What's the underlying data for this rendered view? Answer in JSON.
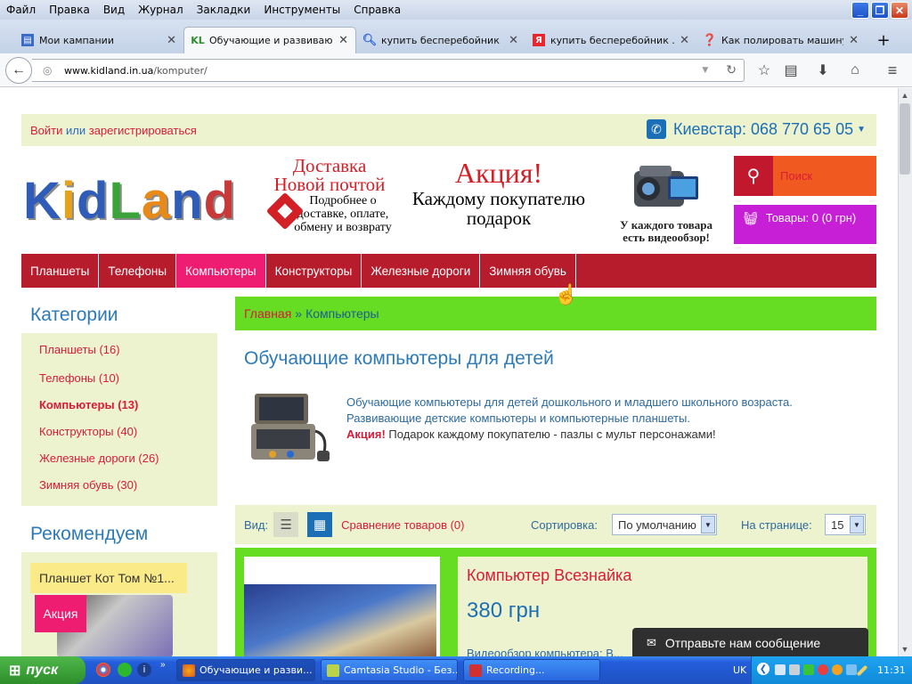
{
  "browser": {
    "menu": [
      "Файл",
      "Правка",
      "Вид",
      "Журнал",
      "Закладки",
      "Инструменты",
      "Справка"
    ],
    "tabs": [
      {
        "label": "Мои кампании",
        "icon": "campaigns-icon"
      },
      {
        "label": "Обучающие и развиваю...",
        "icon": "kidland-favicon"
      },
      {
        "label": "купить бесперебойник ...",
        "icon": "google-icon"
      },
      {
        "label": "купить бесперебойник ...",
        "icon": "yandex-icon"
      },
      {
        "label": "Как полировать машину ...",
        "icon": "question-icon"
      }
    ],
    "url_domain": "www.kidland.in.ua",
    "url_path": "/komputer/"
  },
  "site": {
    "login": "Войти",
    "or": " или ",
    "register": "зарегистрироваться",
    "phone": "Киевстар: 068 770 65 05",
    "logo": "KidLand",
    "delivery_title": "Доставка Новой почтой",
    "delivery_sub": "Подробнее о доставке, оплате, обмену и возврату",
    "promo_title": "Акция!",
    "promo_sub": "Каждому покупателю подарок",
    "video_text": "У каждого товара есть видеообзор!",
    "search_placeholder": "Поиск",
    "cart": "Товары: 0 (0 грн)",
    "nav": [
      "Планшеты",
      "Телефоны",
      "Компьютеры",
      "Конструкторы",
      "Железные дороги",
      "Зимняя обувь"
    ],
    "categories_title": "Категории",
    "categories": [
      "Планшеты (16)",
      "Телефоны (10)",
      "Компьютеры (13)",
      "Конструкторы (40)",
      "Железные дороги (26)",
      "Зимняя обувь (30)"
    ],
    "recommend_title": "Рекомендуем",
    "recommend_item": "Планшет Кот Том №1...",
    "recommend_badge": "Акция",
    "breadcrumb_home": "Главная",
    "breadcrumb_sep": "»",
    "breadcrumb_current": "Компьютеры",
    "page_title": "Обучающие компьютеры для детей",
    "desc_line1": "Обучающие компьютеры для детей дошкольного и младшего школьного возраста.",
    "desc_line2": "Развивающие детские компьютеры и компьютерные планшеты.",
    "desc_promo": "Акция!",
    "desc_promo_text": " Подарок каждому покупателю - пазлы с мульт персонажами!",
    "view_label": "Вид:",
    "compare": "Сравнение товаров (0)",
    "sort_label": "Сортировка:",
    "sort_value": "По умолчанию",
    "perpage_label": "На странице:",
    "perpage_value": "15",
    "product_name": "Компьютер Всезнайка",
    "product_price": "380 грн",
    "product_desc": "Видеообзор компьютера: В...",
    "chat": "Отправьте нам сообщение"
  },
  "taskbar": {
    "start": "пуск",
    "items": [
      "Обучающие и разви...",
      "Camtasia Studio - Без...",
      "Recording..."
    ],
    "lang": "UK",
    "clock": "11:31"
  },
  "colors": {
    "accent_red": "#d81b3c",
    "nav_bg": "#b71c2c",
    "nav_active": "#ee1d72",
    "green": "#66dd22",
    "cream": "#eef3cf",
    "blue": "#2d7ab9"
  }
}
